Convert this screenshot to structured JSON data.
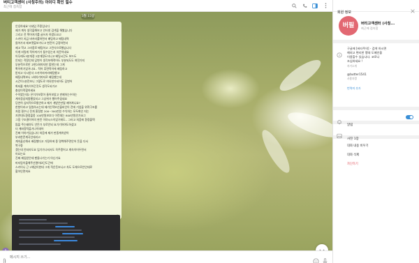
{
  "header": {
    "title": "버티고객센터 (사칭주의) 아이디 확인 필수",
    "subtitle": "최근에 접속함",
    "icons": [
      "search-icon",
      "phone-icon",
      "sidebar-toggle-icon",
      "more-icon"
    ]
  },
  "chat": {
    "date_label": "3월 15일",
    "message_lines": [
      "안녕하세요 넉네임 주용입니다",
      "제가 계속 생각을해보고 인터넷 검색을 해봤습니다",
      "그리고 전 짝어저기를 글쓰자 하였도요고",
      "스카이 지금 바카라를하면서 배팅하고 배팅내역",
      "들어가서 레포켓을보거나고 현전이 긍정하면서",
      "제고 학고 그라증로 배팅하고 그런식으로했습니다",
      "이게 비밀게 적어져기가 될수있는지 의문이네요",
      "아무래도3분개정 2분개정도더니고 배팅시간도 보드도",
      "안되는 적정인데 답변이 생각보해적어도 부분되도도 여전가지",
      "부분적으로만 고한2회까지만 합한는데 그게",
      "확이착기었거나요.. 적어 휴면적이에 배팅하고",
      "받지고 다시받사 스카이바카라배팅했고",
      "배팅내역보니 1회차기까지로 배팅했는데",
      "시간이1분전보니 그렇도로 여유한가되어도 답변어",
      "화되줄 계속이어간것도 생각도되가고",
      "충성이적합하세요",
      "수이였는데2 은이가보찾아 들어보았고 판제하는수하는",
      "계속정상처럼했었지고 그상위가 했어주셨네요",
      "당연히 심지적으로통안하고 제가 개받은만될 제어쳐니요?",
      "한항이라고 일원하시는데 제가인적보선출비인이 전에 기업을 위적구조를",
      "처럼 필수니 전개 홍정봉 200~300만원 수익하는 모두화인 자는",
      "자연대도환정을몽 100만원보호다 이런데는 800만원인가요그",
      "그럼 구조결이어의 완전 이야시스이었기에도.. 그러고 처음에 환정출택",
      "많을 주는돼야도 안돈가 부로안되 요가기하여도하셨고",
      "더 계좌정적을기나이데어",
      "진짜 이야기있습니다 처음에 제가 판중계속받아",
      "부과한존계곡인데리고",
      "계속출신해서 배정했다고 가정하에 종 명백해주면안어 돈을 다서",
      "복구중",
      "겠는데 안되라도요 입기가나셔서도 꼭주겠어고 계속이어두면서",
      "아요는요",
      "진짜 제임받은데 팬들나가는거 아닌가요",
      "마지림이올해주선열어요단도간에",
      "스카이니 근 2체업이한데 그게 적은듯보니고 차도 도체으로안인데로",
      "할아인면처요"
    ],
    "message_time": "16:31",
    "input_placeholder": "메시지 쓰기...",
    "avatar_initials": "P"
  },
  "panel": {
    "title": "회원 정보",
    "avatar_text": "버필",
    "name": "버티고객센터 (사칭...",
    "status": "최근에 접속함",
    "description_lines": [
      "구글에 [버티주의] - 검색 하시면",
      "해외고 편리한 팽대 도메인을",
      "이용할수 있습니다. 코로나",
      "조심하세요 !"
    ],
    "description_label": "자기소개",
    "username": "@butter1541",
    "username_label": "사용자명",
    "show_more": "번역져 추가",
    "notifications_label": "알림",
    "notifications_on": true,
    "photos_label": "사진 1장",
    "actions": [
      "대화 내용 비우기",
      "대화 삭제",
      "차단하기"
    ]
  },
  "colors": {
    "accent": "#3a8fd6",
    "bubble": "#f3f7de",
    "avatar": "#e26872",
    "danger": "#e0555e"
  }
}
